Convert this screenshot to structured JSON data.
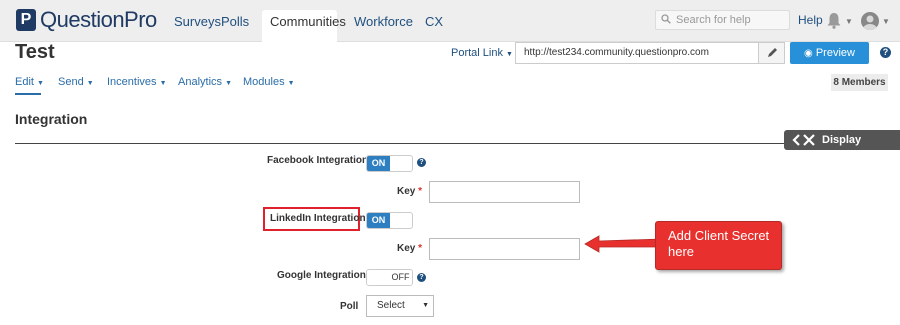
{
  "app": {
    "logo_text": "QuestionPro",
    "nav_tabs": [
      {
        "label": "Surveys"
      },
      {
        "label": "Polls"
      },
      {
        "label": "Communities"
      },
      {
        "label": "Workforce"
      },
      {
        "label": "CX"
      }
    ],
    "active_tab": "Communities",
    "search_placeholder": "Search for help",
    "help_label": "Help"
  },
  "header": {
    "title": "Test",
    "portal_link_label": "Portal Link",
    "portal_url": "http://test234.community.questionpro.com",
    "preview_label": "Preview"
  },
  "subnav": {
    "items": [
      {
        "label": "Edit"
      },
      {
        "label": "Send"
      },
      {
        "label": "Incentives"
      },
      {
        "label": "Analytics"
      },
      {
        "label": "Modules"
      }
    ],
    "members_badge": "8  Members"
  },
  "section": {
    "title": "Integration",
    "display_settings_label": "Display Settings"
  },
  "form": {
    "facebook_label": "Facebook Integration",
    "facebook_toggle": "ON",
    "facebook_key_label": "Key",
    "linkedin_label": "LinkedIn Integration",
    "linkedin_toggle": "ON",
    "linkedin_key_label": "Key",
    "google_label": "Google Integration",
    "google_toggle": "OFF",
    "poll_label": "Poll",
    "poll_select": "Select",
    "required_mark": "*"
  },
  "annotation": {
    "callout_line1": "Add Client Secret",
    "callout_line2": "here",
    "highlight_color": "#e0202a"
  },
  "colors": {
    "brand": "#1f3a63",
    "accent": "#2790d8",
    "toggle_on": "#2d7fc1",
    "callout": "#e8312e"
  }
}
